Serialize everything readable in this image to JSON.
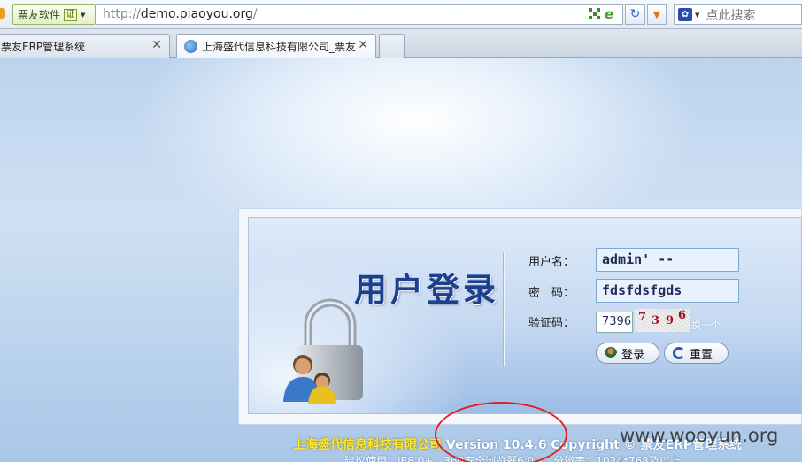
{
  "browser": {
    "site_badge": "票友软件",
    "cert_icon": "证",
    "url_prefix": "http://",
    "url_domain": "demo.piaoyou.org",
    "url_suffix": "/",
    "search_placeholder": "点此搜索",
    "icons": [
      "qr-icon",
      "ie-compat-icon",
      "refresh-icon",
      "dropdown-icon",
      "paw-search-icon"
    ]
  },
  "tabs": [
    {
      "label": "票友ERP管理系统"
    },
    {
      "label": "上海盛代信息科技有限公司_票友"
    }
  ],
  "login": {
    "title": "用户登录",
    "username_label": "用户名：",
    "username_value": "admin' --",
    "password_label": "密　码：",
    "password_value": "fdsfdsfgds",
    "captcha_label": "验证码：",
    "captcha_value": "7396",
    "captcha_digits": [
      "7",
      "3",
      "9",
      "6"
    ],
    "captcha_refresh": "换一个",
    "login_button": "登录",
    "reset_button": "重置"
  },
  "footer": {
    "company": "上海盛代信息科技有限公司",
    "version_text": "Version 10.4.6 Copyright © 票友ERP管理系统",
    "line2": "建议使用：IE8.0+，360安全浏览器6.0+，分辨率：1024*768及以上"
  },
  "watermark": "www.wooyun.org",
  "colors": {
    "title_blue": "#1c3f8e",
    "footer_company": "#ffe830",
    "annotation_red": "#e02020"
  }
}
